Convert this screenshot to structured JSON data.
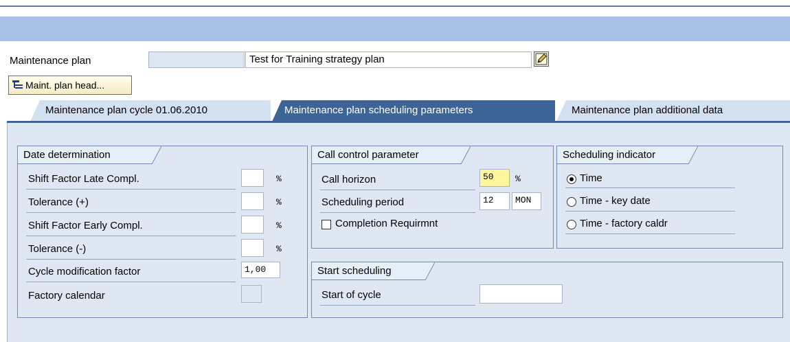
{
  "header": {
    "maintenance_plan_label": "Maintenance plan",
    "maintenance_plan_number": "",
    "maintenance_plan_text": "Test for Training strategy plan",
    "edit_icon": "edit-pencil-icon",
    "maint_plan_header_button": "Maint. plan head..."
  },
  "tabs": [
    {
      "label": "Maintenance plan cycle 01.06.2010",
      "active": false
    },
    {
      "label": "Maintenance plan scheduling parameters",
      "active": true
    },
    {
      "label": "Maintenance plan additional data",
      "active": false
    }
  ],
  "date_determination": {
    "title": "Date determination",
    "rows": [
      {
        "label": "Shift Factor Late Compl.",
        "value": "",
        "unit": "%"
      },
      {
        "label": "Tolerance (+)",
        "value": "",
        "unit": "%"
      },
      {
        "label": "Shift Factor Early Compl.",
        "value": "",
        "unit": "%"
      },
      {
        "label": "Tolerance (-)",
        "value": "",
        "unit": "%"
      },
      {
        "label": "Cycle modification factor",
        "value": "1,00",
        "unit": ""
      },
      {
        "label": "Factory calendar",
        "value": "",
        "unit": ""
      }
    ]
  },
  "call_control": {
    "title": "Call control parameter",
    "call_horizon_label": "Call horizon",
    "call_horizon_value": "50",
    "call_horizon_unit": "%",
    "scheduling_period_label": "Scheduling period",
    "scheduling_period_value": "12",
    "scheduling_period_unit": "MON",
    "completion_label": "Completion Requirmnt",
    "completion_checked": false
  },
  "scheduling_indicator": {
    "title": "Scheduling indicator",
    "options": [
      {
        "label": "Time",
        "selected": true
      },
      {
        "label": "Time - key date",
        "selected": false
      },
      {
        "label": "Time - factory caldr",
        "selected": false
      }
    ]
  },
  "start_scheduling": {
    "title": "Start scheduling",
    "start_of_cycle_label": "Start of cycle",
    "start_of_cycle_value": ""
  },
  "colors": {
    "toolbar": "#a7c0e3",
    "active_tab": "#3d6496",
    "content_bg": "#dfe8f2",
    "highlight_field": "#fff79a"
  }
}
